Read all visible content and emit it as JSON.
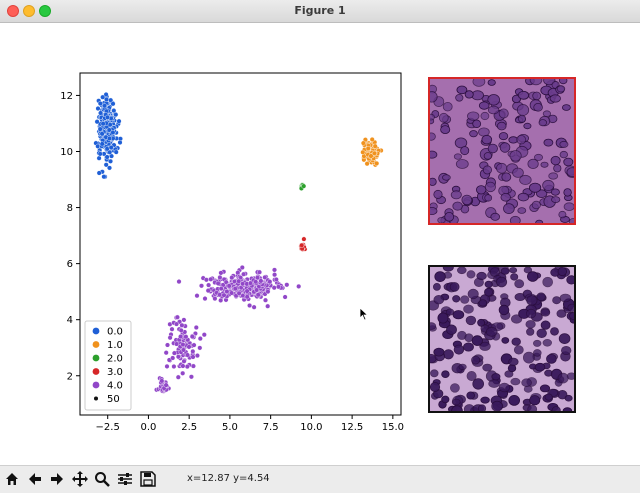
{
  "window": {
    "title": "Figure 1"
  },
  "chart_data": {
    "type": "scatter",
    "x_ticks": [
      "−2.5",
      "0.0",
      "2.5",
      "5.0",
      "7.5",
      "10.0",
      "12.5",
      "15.0"
    ],
    "y_ticks": [
      "2",
      "4",
      "6",
      "8",
      "10",
      "12"
    ],
    "xlim": [
      -4.2,
      15.5
    ],
    "ylim": [
      0.6,
      12.8
    ],
    "legend": {
      "placement": "lower-left",
      "entries": [
        {
          "label": "0.0",
          "color": "#1f5fd6"
        },
        {
          "label": "1.0",
          "color": "#f0921e"
        },
        {
          "label": "2.0",
          "color": "#2ca02c"
        },
        {
          "label": "3.0",
          "color": "#d62728"
        },
        {
          "label": "4.0",
          "color": "#9147c8"
        },
        {
          "label": "50",
          "color": "#111111"
        }
      ]
    },
    "series": [
      {
        "name": "0.0",
        "color": "#1f5fd6",
        "clusters": [
          {
            "center": [
              -2.5,
              10.8
            ],
            "spread": [
              0.55,
              1.1
            ],
            "count": 260
          }
        ]
      },
      {
        "name": "1.0",
        "color": "#f0921e",
        "clusters": [
          {
            "center": [
              13.6,
              9.95
            ],
            "spread": [
              0.5,
              0.4
            ],
            "count": 90
          }
        ]
      },
      {
        "name": "2.0",
        "color": "#2ca02c",
        "clusters": [
          {
            "center": [
              9.45,
              8.7
            ],
            "spread": [
              0.15,
              0.12
            ],
            "count": 8
          }
        ]
      },
      {
        "name": "3.0",
        "color": "#d62728",
        "clusters": [
          {
            "center": [
              9.5,
              6.6
            ],
            "spread": [
              0.15,
              0.22
            ],
            "count": 14
          }
        ]
      },
      {
        "name": "4.0",
        "color": "#9147c8",
        "clusters": [
          {
            "center": [
              5.7,
              5.2
            ],
            "spread": [
              2.2,
              0.45
            ],
            "count": 300
          },
          {
            "center": [
              2.1,
              3.0
            ],
            "spread": [
              0.9,
              1.1
            ],
            "count": 90
          },
          {
            "center": [
              0.9,
              1.6
            ],
            "spread": [
              0.3,
              0.25
            ],
            "count": 30
          }
        ]
      }
    ]
  },
  "tissue_images": [
    {
      "name": "tissue-patch-red",
      "border": "#d62728"
    },
    {
      "name": "tissue-patch-black",
      "border": "#111111"
    }
  ],
  "toolbar": {
    "buttons": [
      "home-icon",
      "back-icon",
      "forward-icon",
      "pan-icon",
      "zoom-icon",
      "configure-icon",
      "save-icon"
    ],
    "coords": "x=12.87 y=4.54"
  }
}
